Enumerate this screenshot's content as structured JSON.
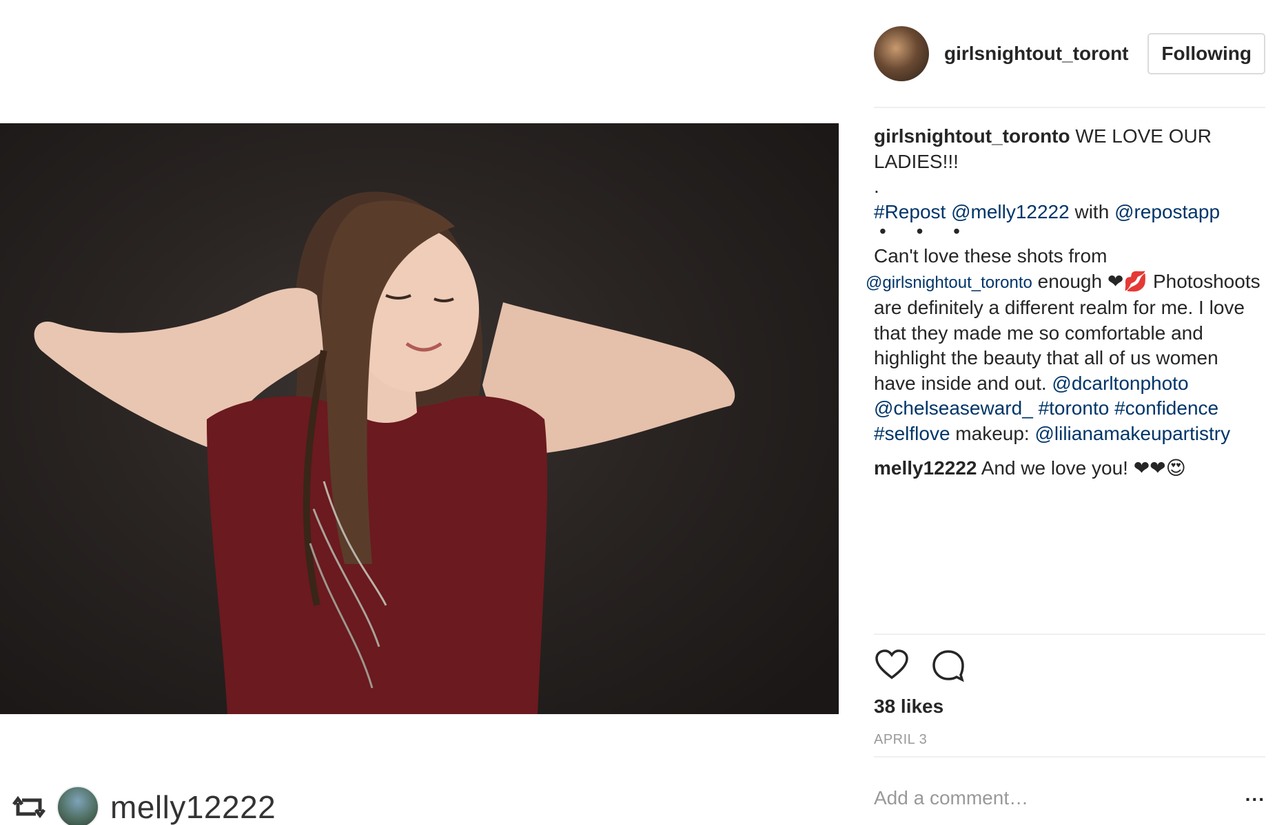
{
  "post": {
    "author": "girlsnightout_toront",
    "follow_label": "Following",
    "likes": "38 likes",
    "date": "APRIL 3"
  },
  "caption": {
    "user": "girlsnightout_toronto",
    "text1": " WE LOVE OUR",
    "text2": "LADIES!!!",
    "dot": ".",
    "repost_tag": "#Repost",
    "repost_user": "@melly12222",
    "repost_with": " with ",
    "repost_app": "@repostapp",
    "separator": "• • •",
    "line1": "Can't love these shots from",
    "mention1": "@girlsnightout_toronto",
    "line2a": " enough ❤💋 Photoshoots",
    "line3": "are definitely a different realm for me. I love",
    "line4": "that they made me so comfortable and",
    "line5": "highlight the beauty that all of us women",
    "line6a": "have inside and out. ",
    "mention2": "@dcarltonphoto",
    "mention3": "@chelseaseward_",
    "tag1": "#toronto",
    "tag2": "#confidence",
    "tag3": "#selflove",
    "makeup_label": " makeup: ",
    "mention4": "@lilianamakeupartistry"
  },
  "reply": {
    "user": "melly12222",
    "text": " And we love you! ❤❤😍"
  },
  "comment_box": {
    "placeholder": "Add a comment…",
    "more": "..."
  },
  "repost_badge": {
    "username": "melly12222"
  },
  "icons": {
    "like": "heart-icon",
    "comment": "speech-bubble-icon",
    "repost": "repost-icon"
  },
  "colors": {
    "link": "#003569",
    "text": "#262626",
    "muted": "#999999",
    "divider": "#efefef"
  }
}
